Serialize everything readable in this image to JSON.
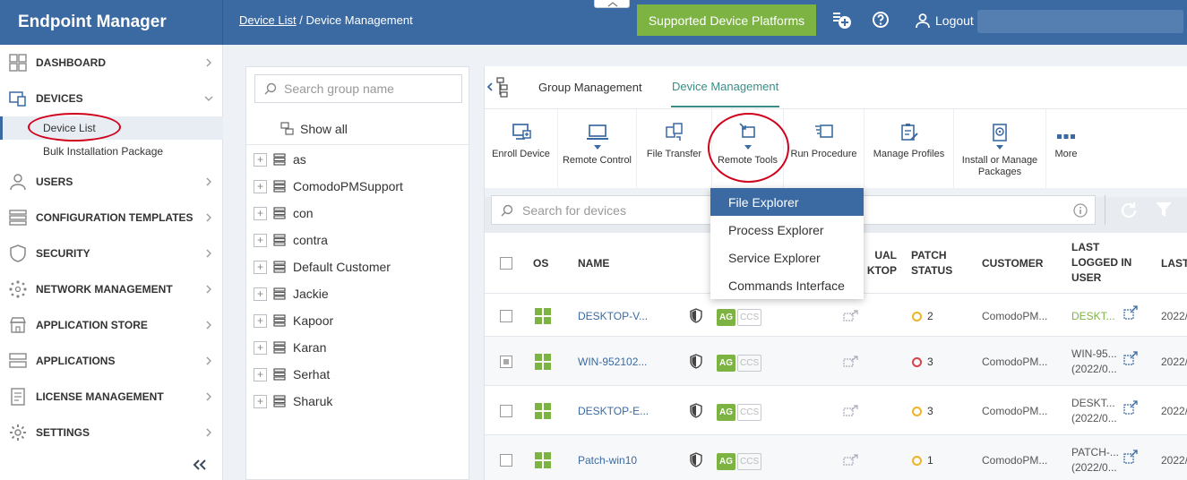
{
  "header": {
    "brand": "Endpoint Manager",
    "breadcrumb": {
      "link": "Device List",
      "separator": "/",
      "current": "Device Management"
    },
    "platforms_button": "Supported Device Platforms",
    "logout": "Logout"
  },
  "sidebar": {
    "items": [
      {
        "label": "DASHBOARD",
        "icon": "dashboard-icon"
      },
      {
        "label": "DEVICES",
        "icon": "devices-icon"
      },
      {
        "label": "USERS",
        "icon": "users-icon"
      },
      {
        "label": "CONFIGURATION TEMPLATES",
        "icon": "configuration-templates-icon"
      },
      {
        "label": "SECURITY",
        "icon": "security-shield-icon"
      },
      {
        "label": "NETWORK MANAGEMENT",
        "icon": "network-icon"
      },
      {
        "label": "APPLICATION STORE",
        "icon": "store-icon"
      },
      {
        "label": "APPLICATIONS",
        "icon": "applications-icon"
      },
      {
        "label": "LICENSE MANAGEMENT",
        "icon": "license-icon"
      },
      {
        "label": "SETTINGS",
        "icon": "gear-icon"
      }
    ],
    "devices_sub": [
      "Device List",
      "Bulk Installation Package"
    ],
    "collapse": "«"
  },
  "groups": {
    "search_placeholder": "Search group name",
    "show_all": "Show all",
    "nodes": [
      "as",
      "ComodoPMSupport",
      "con",
      "contra",
      "Default Customer",
      "Jackie",
      "Kapoor",
      "Karan",
      "Serhat",
      "Sharuk"
    ]
  },
  "tabs": [
    "Group Management",
    "Device Management"
  ],
  "toolbar": [
    {
      "label": "Enroll Device",
      "caret": false
    },
    {
      "label": "Remote Control",
      "caret": true
    },
    {
      "label": "File Transfer",
      "caret": false
    },
    {
      "label": "Remote Tools",
      "caret": true
    },
    {
      "label": "Run Procedure",
      "caret": false
    },
    {
      "label": "Manage Profiles",
      "caret": false
    },
    {
      "label": "Install or Manage Packages",
      "caret": true
    },
    {
      "label": "More",
      "caret": false
    }
  ],
  "device_search_placeholder": "Search for devices",
  "remote_tools_menu": [
    "File Explorer",
    "Process Explorer",
    "Service Explorer",
    "Commands Interface"
  ],
  "table": {
    "columns": {
      "os": "OS",
      "name": "NAME",
      "virtual_desktop": "VIRTUAL DESKTOP",
      "virtual_desktop_visible": "UAL KTOP",
      "patch_status": "PATCH STATUS",
      "customer": "CUSTOMER",
      "last_logged_in_user": "LAST LOGGED IN USER",
      "last": "LAST"
    },
    "rows": [
      {
        "name": "DESKTOP-V...",
        "ag": "AG",
        "ccs": "CCS",
        "patch": "2",
        "patch_status": "warning",
        "customer": "ComodoPM...",
        "user_l1": "DESKT...",
        "user_l2": "",
        "last": "2022/",
        "checked": false
      },
      {
        "name": "WIN-952102...",
        "ag": "AG",
        "ccs": "CCS",
        "patch": "3",
        "patch_status": "error",
        "customer": "ComodoPM...",
        "user_l1": "WIN-95...",
        "user_l2": "(2022/0...",
        "last": "2022/",
        "checked": true
      },
      {
        "name": "DESKTOP-E...",
        "ag": "AG",
        "ccs": "CCS",
        "patch": "3",
        "patch_status": "warning",
        "customer": "ComodoPM...",
        "user_l1": "DESKT...",
        "user_l2": "(2022/0...",
        "last": "2022/",
        "checked": false
      },
      {
        "name": "Patch-win10",
        "ag": "AG",
        "ccs": "CCS",
        "patch": "1",
        "patch_status": "warning",
        "customer": "ComodoPM...",
        "user_l1": "PATCH-...",
        "user_l2": "(2022/0...",
        "last": "2022/",
        "checked": false
      }
    ]
  },
  "colors": {
    "header": "#3b6aa2",
    "accent_green": "#7cb342",
    "tab_active": "#3b8e87",
    "annotation": "#d0021b",
    "warning": "#f0b323",
    "error": "#d9414c"
  }
}
